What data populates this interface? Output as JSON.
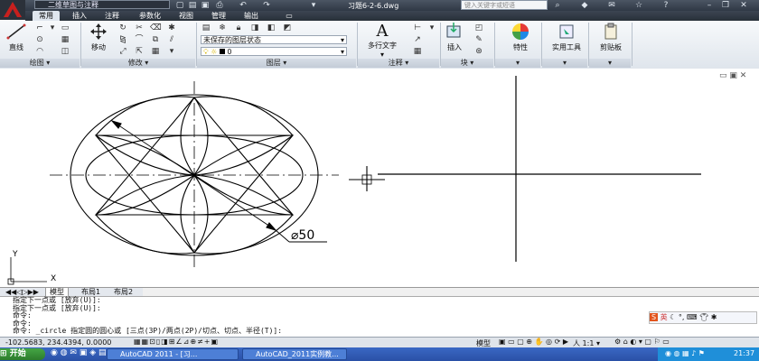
{
  "title_bar": {
    "workspace": "二维草图与注释",
    "document_title": "习题6-2-6.dwg",
    "search_placeholder": "键入关键字或短语"
  },
  "menu_tabs": [
    "常用",
    "插入",
    "注释",
    "参数化",
    "视图",
    "管理",
    "输出"
  ],
  "ribbon": {
    "panels": {
      "draw": "绘图",
      "modify": "修改",
      "layers": "图层",
      "annotation": "注释",
      "block": "块"
    },
    "buttons": {
      "line": "直线",
      "move": "移动",
      "mtext": "多行文字",
      "insert": "插入",
      "properties": "特性",
      "utilities": "实用工具",
      "clipboard": "剪贴板"
    },
    "layer_state": "未保存的图层状态",
    "current_layer": "0"
  },
  "drawing": {
    "dimension_label": "⌀50",
    "ucs_x": "X",
    "ucs_y": "Y"
  },
  "layout_tabs": [
    "模型",
    "布局1",
    "布局2"
  ],
  "command_lines": [
    "指定下一点或 [放弃(U)]:",
    "指定下一点或 [放弃(U)]:",
    "命令:",
    "命令:",
    "命令: _circle 指定圆的圆心或 [三点(3P)/两点(2P)/切点、切点、半径(T)]:"
  ],
  "ime_label": "英",
  "status_bar": {
    "coordinates": "-102.5683, 234.4394, 0.0000",
    "model_label": "模型",
    "scale": "1:1"
  },
  "taskbar": {
    "start_label": "开始",
    "tasks": [
      "AutoCAD 2011 - [习...",
      "AutoCAD_2011实例教..."
    ],
    "clock": "21:37"
  },
  "colors": {
    "title_bg": "#2f3845",
    "ribbon_bg": "#e4e9ef",
    "taskbar": "#2a50a6",
    "start_button": "#3a9a3a"
  }
}
